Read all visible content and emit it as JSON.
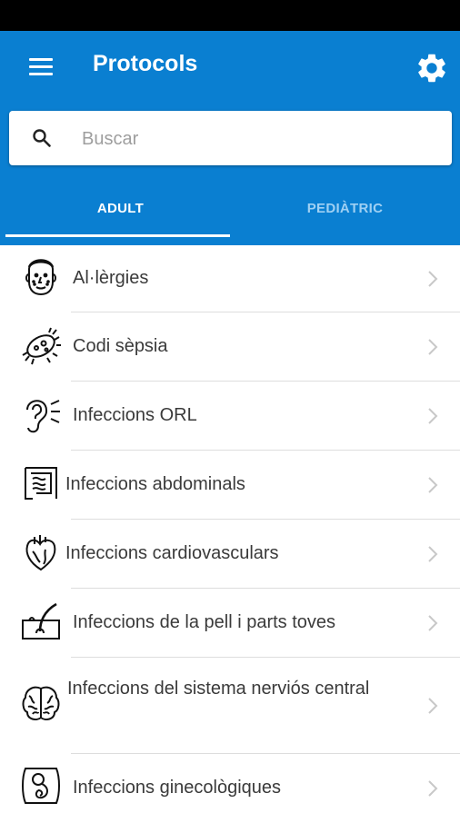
{
  "app_bar": {
    "title": "Protocols",
    "menu_icon": "menu-icon",
    "settings_icon": "gear-icon",
    "color": "#0a7fd1"
  },
  "search": {
    "placeholder": "Buscar",
    "value": ""
  },
  "tabs": [
    {
      "label": "ADULT",
      "selected": true
    },
    {
      "label": "PEDIÀTRIC",
      "selected": false
    }
  ],
  "list": {
    "items": [
      {
        "label": "Al·lèrgies",
        "icon": "face-allergy-icon"
      },
      {
        "label": "Codi sèpsia",
        "icon": "bacteria-icon"
      },
      {
        "label": "Infeccions ORL",
        "icon": "ear-icon"
      },
      {
        "label": "Infeccions abdominals",
        "icon": "intestine-icon"
      },
      {
        "label": "Infeccions cardiovasculars",
        "icon": "heart-icon"
      },
      {
        "label": "Infeccions de la pell i parts toves",
        "icon": "skin-hair-icon"
      },
      {
        "label": "Infeccions del sistema nerviós central",
        "icon": "brain-icon"
      },
      {
        "label": "Infeccions ginecològiques",
        "icon": "fetus-icon"
      }
    ]
  }
}
